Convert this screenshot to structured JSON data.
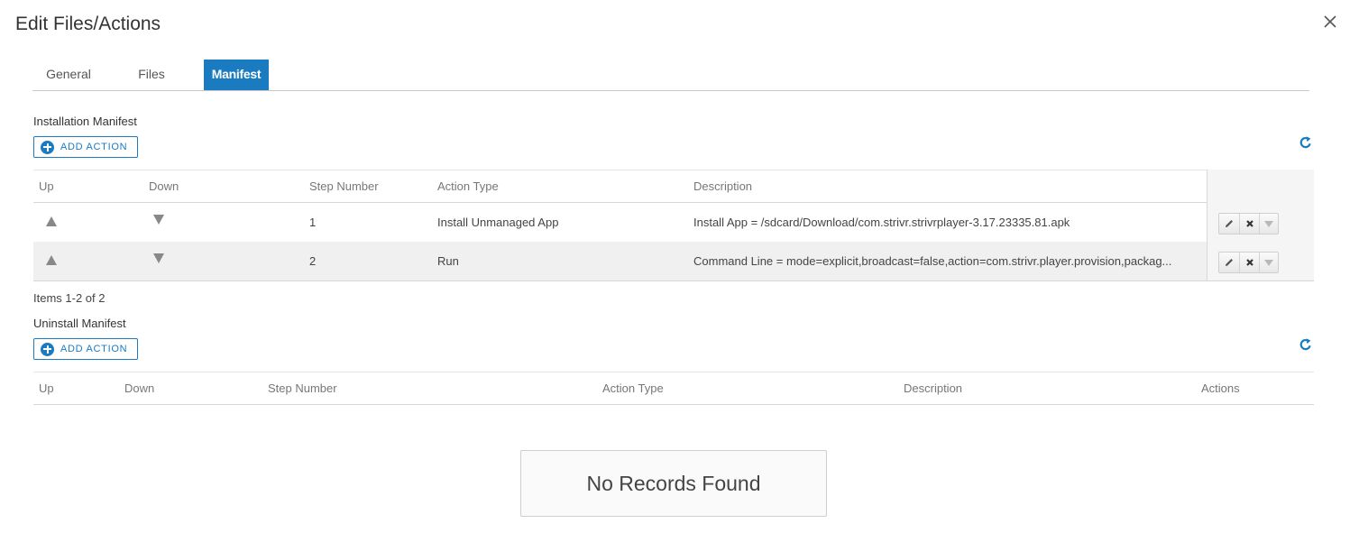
{
  "dialog": {
    "title": "Edit Files/Actions"
  },
  "tabs": [
    {
      "label": "General",
      "active": false
    },
    {
      "label": "Files",
      "active": false
    },
    {
      "label": "Manifest",
      "active": true
    }
  ],
  "installation": {
    "label": "Installation Manifest",
    "add_label": "ADD ACTION",
    "columns": {
      "up": "Up",
      "down": "Down",
      "step": "Step Number",
      "type": "Action Type",
      "description": "Description"
    },
    "rows": [
      {
        "step": "1",
        "type": "Install Unmanaged App",
        "description": "Install App = /sdcard/Download/com.strivr.strivrplayer-3.17.23335.81.apk"
      },
      {
        "step": "2",
        "type": "Run",
        "description": "Command Line = mode=explicit,broadcast=false,action=com.strivr.player.provision,packag..."
      }
    ],
    "items_count": "Items 1-2 of 2"
  },
  "uninstall": {
    "label": "Uninstall Manifest",
    "add_label": "ADD ACTION",
    "columns": {
      "up": "Up",
      "down": "Down",
      "step": "Step Number",
      "type": "Action Type",
      "description": "Description",
      "actions": "Actions"
    },
    "empty_message": "No Records Found"
  },
  "colors": {
    "accent": "#1a7bc0",
    "row_alt": "#f0f0f0"
  },
  "icons": [
    "close-icon",
    "plus-circle-icon",
    "refresh-icon",
    "arrow-up-icon",
    "arrow-down-icon",
    "pencil-icon",
    "delete-x-icon",
    "caret-down-icon"
  ]
}
